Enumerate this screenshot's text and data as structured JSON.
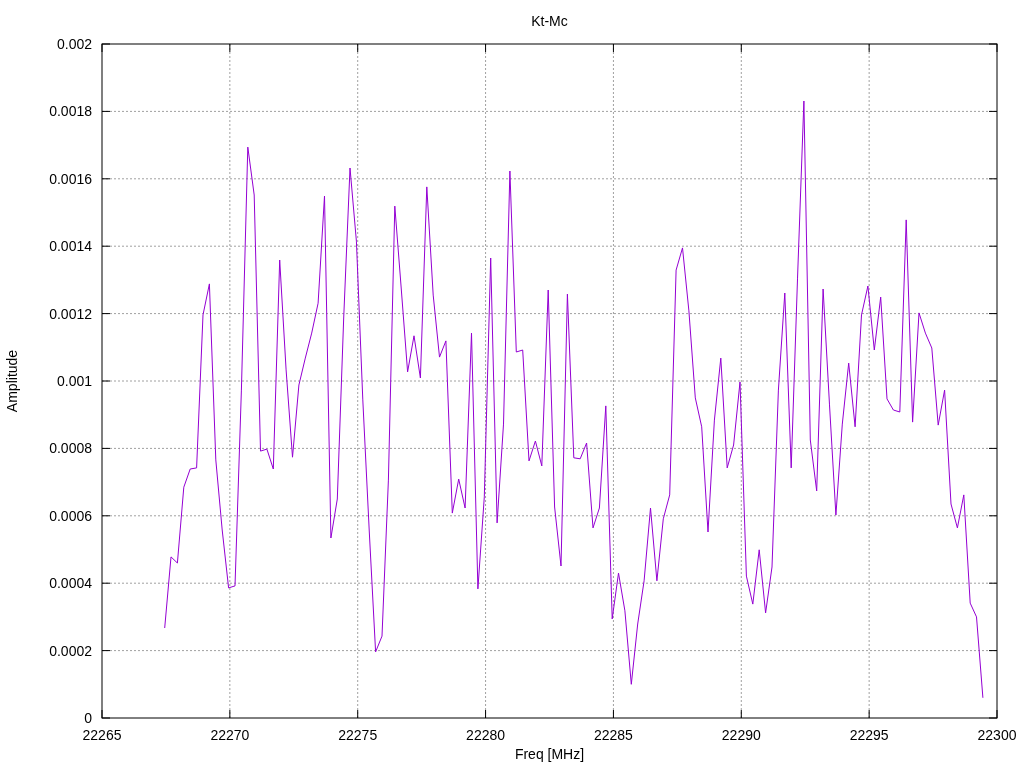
{
  "chart_data": {
    "type": "line",
    "grid": true,
    "title": "Kt-Mc",
    "xlabel": "Freq [MHz]",
    "ylabel": "Amplitude",
    "xlim": [
      22265,
      22300
    ],
    "ylim": [
      0,
      0.002
    ],
    "xticks": [
      22265,
      22270,
      22275,
      22280,
      22285,
      22290,
      22295,
      22300
    ],
    "yticks": [
      0,
      0.0002,
      0.0004,
      0.0006,
      0.0008,
      0.001,
      0.0012,
      0.0014,
      0.0016,
      0.0018,
      0.002
    ],
    "x": [
      22267.45,
      22267.7,
      22267.95,
      22268.2,
      22268.45,
      22268.7,
      22268.95,
      22269.2,
      22269.45,
      22269.7,
      22269.95,
      22270.2,
      22270.45,
      22270.7,
      22270.95,
      22271.2,
      22271.45,
      22271.7,
      22271.95,
      22272.2,
      22272.45,
      22272.7,
      22272.95,
      22273.2,
      22273.45,
      22273.7,
      22273.95,
      22274.2,
      22274.45,
      22274.7,
      22274.95,
      22275.2,
      22275.45,
      22275.7,
      22275.95,
      22276.2,
      22276.45,
      22276.7,
      22276.95,
      22277.2,
      22277.45,
      22277.7,
      22277.95,
      22278.2,
      22278.45,
      22278.7,
      22278.95,
      22279.2,
      22279.45,
      22279.7,
      22279.95,
      22280.2,
      22280.45,
      22280.7,
      22280.95,
      22281.2,
      22281.45,
      22281.7,
      22281.95,
      22282.2,
      22282.45,
      22282.7,
      22282.95,
      22283.2,
      22283.45,
      22283.7,
      22283.95,
      22284.2,
      22284.45,
      22284.7,
      22284.95,
      22285.2,
      22285.45,
      22285.7,
      22285.95,
      22286.2,
      22286.45,
      22286.7,
      22286.95,
      22287.2,
      22287.45,
      22287.7,
      22287.95,
      22288.2,
      22288.45,
      22288.7,
      22288.95,
      22289.2,
      22289.45,
      22289.7,
      22289.95,
      22290.2,
      22290.45,
      22290.7,
      22290.95,
      22291.2,
      22291.45,
      22291.7,
      22291.95,
      22292.2,
      22292.45,
      22292.7,
      22292.95,
      22293.2,
      22293.45,
      22293.7,
      22293.95,
      22294.2,
      22294.45,
      22294.7,
      22294.95,
      22295.2,
      22295.45,
      22295.7,
      22295.95,
      22296.2,
      22296.45,
      22296.7,
      22296.95,
      22297.2,
      22297.45,
      22297.7,
      22297.95,
      22298.2,
      22298.45,
      22298.7,
      22298.95,
      22299.2,
      22299.45
    ],
    "series": [
      {
        "color": "#9400d3",
        "values": [
          0.000267,
          0.000478,
          0.00046,
          0.000685,
          0.000739,
          0.000742,
          0.001196,
          0.001288,
          0.000766,
          0.000558,
          0.000386,
          0.000392,
          0.000973,
          0.001694,
          0.001552,
          0.000792,
          0.000798,
          0.000739,
          0.001359,
          0.001033,
          0.000774,
          0.000988,
          0.001068,
          0.001142,
          0.001231,
          0.001549,
          0.000534,
          0.00065,
          0.001187,
          0.001632,
          0.001415,
          0.000944,
          0.000558,
          0.000196,
          0.000243,
          0.000706,
          0.001519,
          0.001276,
          0.001027,
          0.001134,
          0.001009,
          0.001576,
          0.001255,
          0.001071,
          0.001119,
          0.000608,
          0.000709,
          0.000623,
          0.001142,
          0.000383,
          0.000656,
          0.001365,
          0.000579,
          0.000872,
          0.001623,
          0.001086,
          0.001092,
          0.000763,
          0.000822,
          0.000748,
          0.00127,
          0.000626,
          0.000451,
          0.001258,
          0.000772,
          0.000769,
          0.000816,
          0.000564,
          0.000623,
          0.000926,
          0.000294,
          0.00043,
          0.000318,
          0.0001,
          0.000279,
          0.000407,
          0.000623,
          0.000407,
          0.000591,
          0.000662,
          0.001329,
          0.001395,
          0.001208,
          0.00095,
          0.000864,
          0.000552,
          0.000884,
          0.001068,
          0.000742,
          0.00081,
          0.000997,
          0.000421,
          0.000338,
          0.000499,
          0.000312,
          0.000448,
          0.000973,
          0.001261,
          0.000742,
          0.001303,
          0.001831,
          0.000825,
          0.000674,
          0.001273,
          0.000929,
          0.000602,
          0.000872,
          0.001053,
          0.000864,
          0.001196,
          0.001282,
          0.001092,
          0.001249,
          0.000947,
          0.000914,
          0.000908,
          0.001478,
          0.000878,
          0.001202,
          0.001142,
          0.001098,
          0.000869,
          0.000973,
          0.000635,
          0.000564,
          0.000662,
          0.000341,
          0.0003,
          6e-05
        ]
      }
    ]
  }
}
